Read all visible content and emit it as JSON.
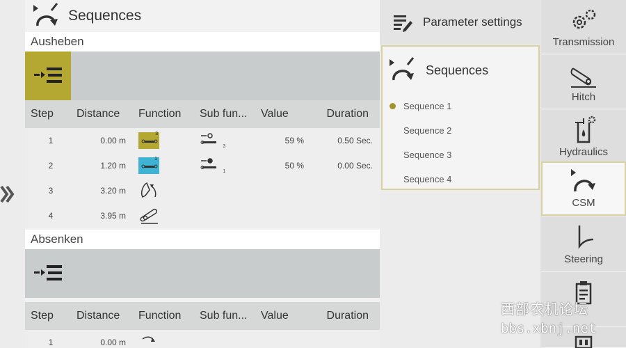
{
  "main": {
    "title": "Sequences",
    "sections": [
      {
        "title": "Ausheben",
        "columns": [
          "Step",
          "Distance",
          "Function",
          "Sub fun...",
          "Value",
          "Duration"
        ],
        "rows": [
          {
            "step": "1",
            "distance": "0.00 m",
            "function_icon": "hitch-raise-function-icon",
            "function_badge": "3",
            "sub_icon": "valve-port-icon",
            "sub_value": "3",
            "value": "59 %",
            "duration": "0.50 Sec."
          },
          {
            "step": "2",
            "distance": "1.20 m",
            "function_icon": "hitch-lower-function-icon",
            "function_badge": "1",
            "sub_icon": "valve-port-icon",
            "sub_value": "1",
            "value": "50 %",
            "duration": "0.00 Sec."
          },
          {
            "step": "3",
            "distance": "3.20 m",
            "function_icon": "rear-hitch-icon",
            "value": "",
            "duration": ""
          },
          {
            "step": "4",
            "distance": "3.95 m",
            "function_icon": "pto-icon",
            "value": "",
            "duration": ""
          }
        ]
      },
      {
        "title": "Absenken",
        "columns": [
          "Step",
          "Distance",
          "Function",
          "Sub fun...",
          "Value",
          "Duration"
        ],
        "partial_row": {
          "step": "1",
          "distance": "0.00 m"
        }
      }
    ]
  },
  "param": {
    "header": "Parameter settings",
    "panel_title": "Sequences",
    "items": [
      {
        "label": "Sequence 1",
        "active": true
      },
      {
        "label": "Sequence 2",
        "active": false
      },
      {
        "label": "Sequence 3",
        "active": false
      },
      {
        "label": "Sequence 4",
        "active": false
      }
    ]
  },
  "nav": {
    "items": [
      {
        "label": "Transmission",
        "icon": "gears-icon"
      },
      {
        "label": "Hitch",
        "icon": "hitch-icon"
      },
      {
        "label": "Hydraulics",
        "icon": "hydraulics-icon"
      },
      {
        "label": "CSM",
        "icon": "csm-icon",
        "selected": true
      },
      {
        "label": "Steering",
        "icon": "steering-icon"
      }
    ]
  },
  "watermark": {
    "cn": "西部农机论坛",
    "url": "bbs.xbnj.net"
  },
  "colors": {
    "accent_olive": "#b5a832",
    "accent_cyan": "#3fb3d4",
    "selection_border": "#d8d2a0"
  }
}
